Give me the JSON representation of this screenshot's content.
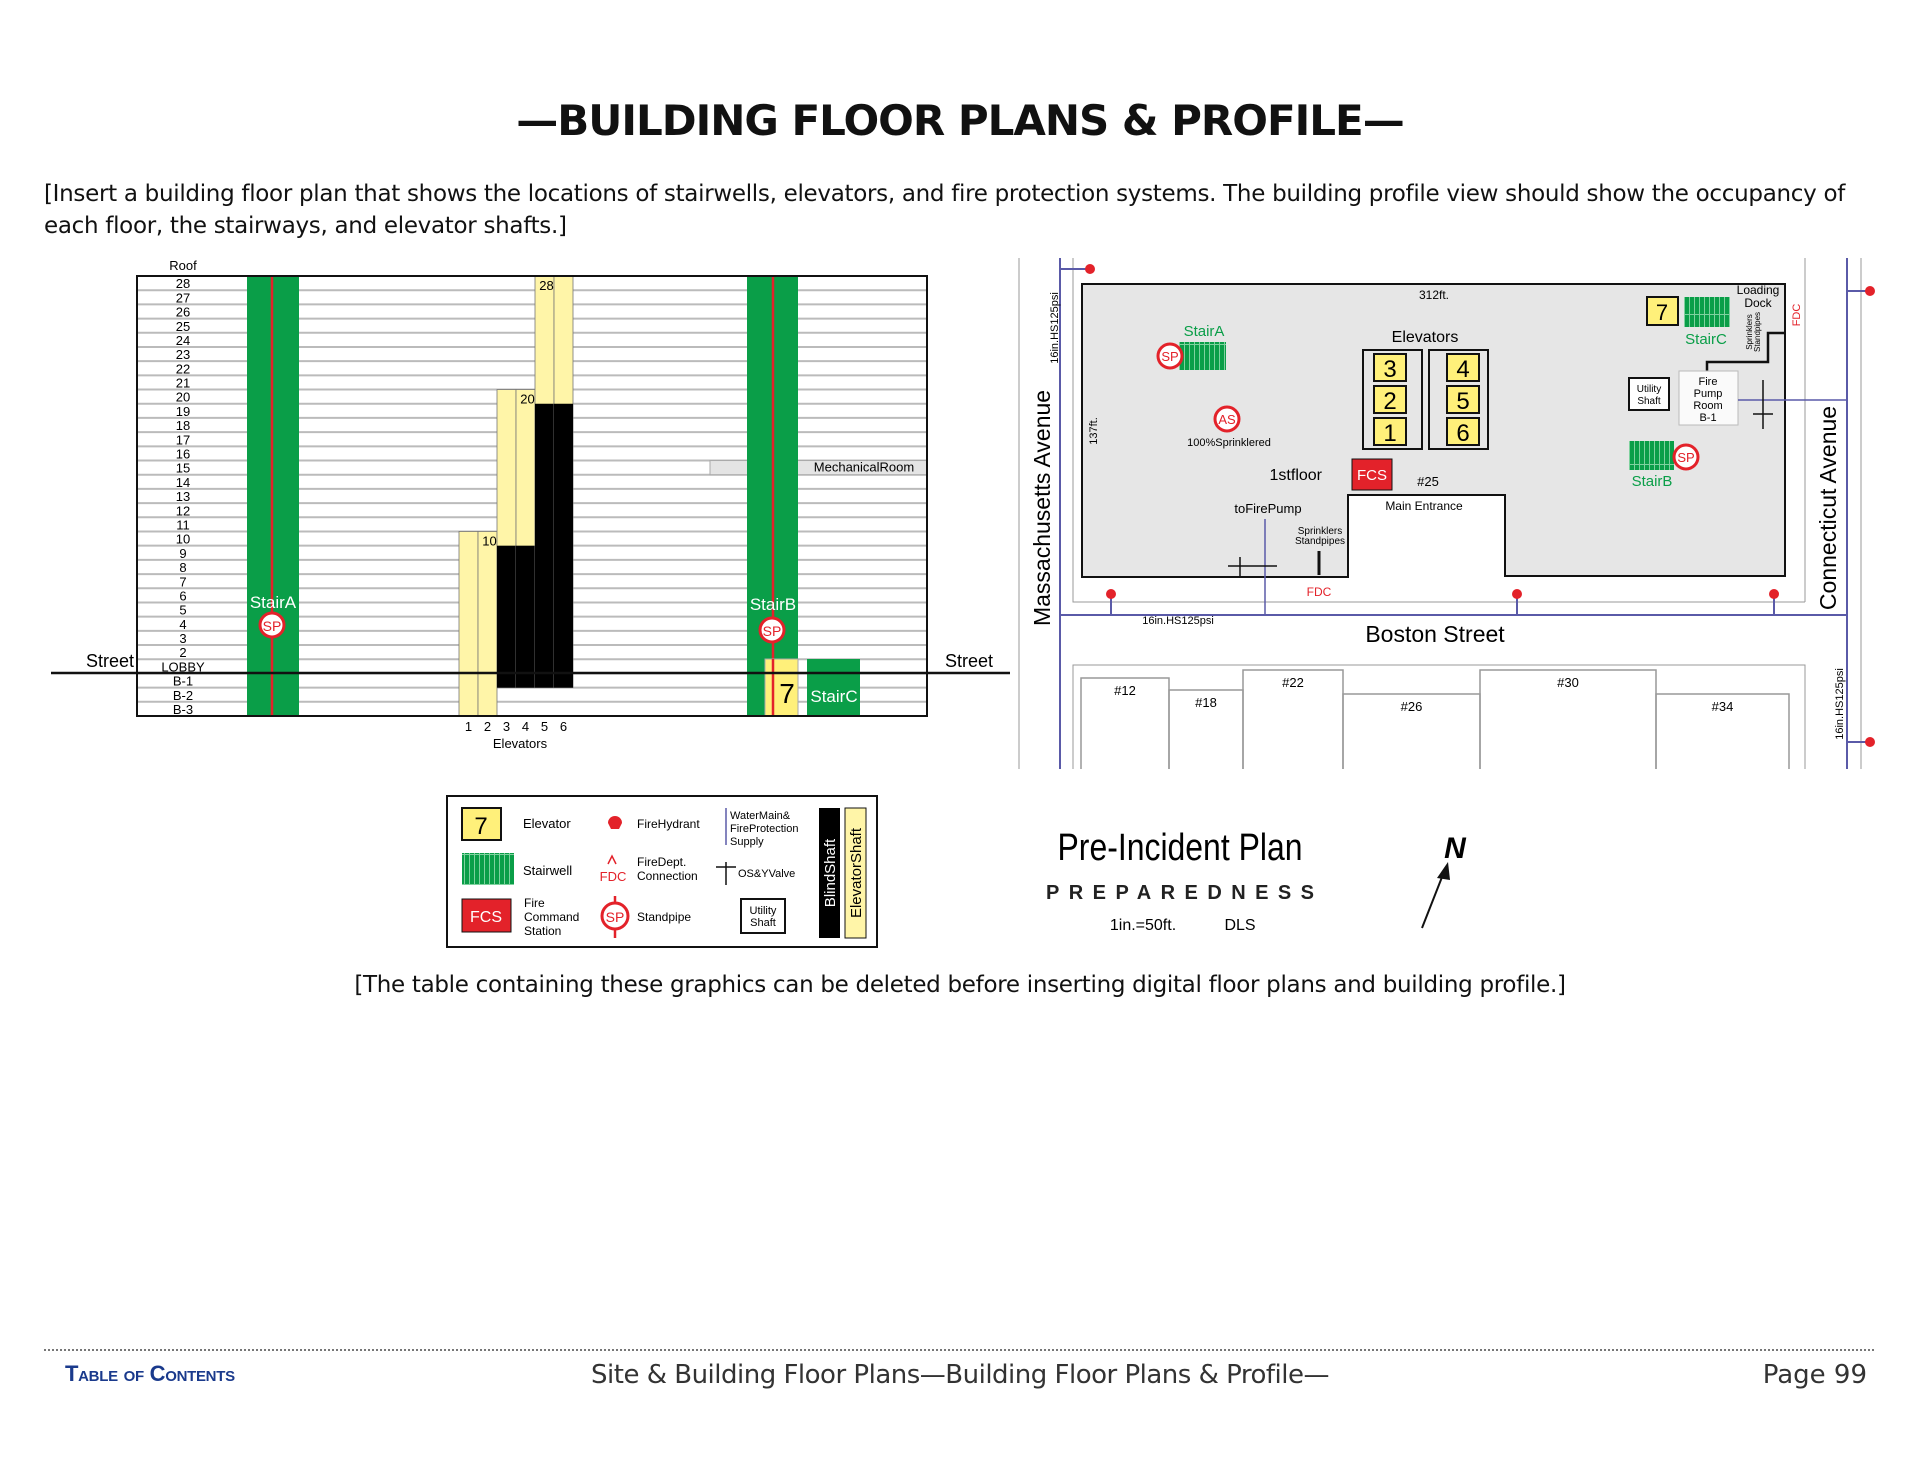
{
  "title": "—BUILDING FLOOR PLANS & PROFILE—",
  "intro": "[Insert a building floor plan that shows the locations of stairwells, elevators, and fire protection systems. The building profile view should show the occupancy of each floor, the stairways, and elevator shafts.]",
  "note": "[The table containing these graphics can be deleted before inserting digital floor plans and building profile.]",
  "profile": {
    "roof_label": "Roof",
    "floors": [
      "28",
      "27",
      "26",
      "25",
      "24",
      "23",
      "22",
      "21",
      "20",
      "19",
      "18",
      "17",
      "16",
      "15",
      "14",
      "13",
      "12",
      "11",
      "10",
      "9",
      "8",
      "7",
      "6",
      "5",
      "4",
      "3",
      "2",
      "LOBBY",
      "B-1",
      "B-2",
      "B-3"
    ],
    "street_left": "Street",
    "street_right": "Street",
    "stair_a": "StairA",
    "stair_b": "StairB",
    "stair_c": "StairC",
    "sp": "SP",
    "elevator_7": "7",
    "mechanical_room": "MechanicalRoom",
    "mechanical_floor": "15",
    "elevators_label": "Elevators",
    "elevators": [
      {
        "id": "1",
        "top": "10",
        "bottom": "B-3",
        "blind_from": null,
        "blind_to": null,
        "top_label": ""
      },
      {
        "id": "2",
        "top": "10",
        "bottom": "B-3",
        "blind_from": null,
        "blind_to": null,
        "top_label": "10"
      },
      {
        "id": "3",
        "top": "20",
        "bottom": "B-1",
        "blind_from": "9",
        "blind_to": "B-1",
        "top_label": ""
      },
      {
        "id": "4",
        "top": "20",
        "bottom": "B-1",
        "blind_from": "9",
        "blind_to": "B-1",
        "top_label": "20"
      },
      {
        "id": "5",
        "top": "28",
        "bottom": "B-1",
        "blind_from": "19",
        "blind_to": "B-1",
        "top_label": "28"
      },
      {
        "id": "6",
        "top": "28",
        "bottom": "B-1",
        "blind_from": "19",
        "blind_to": "B-1",
        "top_label": ""
      }
    ]
  },
  "map": {
    "main_left": "16in.HS125psi",
    "main_bottom": "16in.HS125psi",
    "main_right": "16in.HS125psi",
    "mass_ave": "Massachusetts Avenue",
    "conn_ave": "Connecticut Avenue",
    "boston_st": "Boston Street",
    "width_ft": "312ft.",
    "depth_ft": "137ft.",
    "stair_a": "StairA",
    "stair_b": "StairB",
    "stair_c": "StairC",
    "sp": "SP",
    "as": "AS",
    "sprinklered": "100%Sprinklered",
    "elevators_label": "Elevators",
    "elevator_cars": [
      "3",
      "2",
      "1",
      "4",
      "5",
      "6"
    ],
    "elevator_7": "7",
    "first_floor": "1stfloor",
    "fcs": "FCS",
    "address": "#25",
    "main_entrance": "Main Entrance",
    "to_fire_pump": "toFirePump",
    "sprinklers": "Sprinklers",
    "standpipes": "Standpipes",
    "fdc": "FDC",
    "loading": "Loading",
    "dock": "Dock",
    "utility": "Utility",
    "shaft": "Shaft",
    "fire_pump_room": [
      "Fire",
      "Pump",
      "Room",
      "B-1"
    ],
    "neighbors": [
      "#12",
      "#18",
      "#22",
      "#26",
      "#30",
      "#34"
    ]
  },
  "legend": {
    "elevator_num": "7",
    "elevator": "Elevator",
    "stairwell": "Stairwell",
    "fcs": "FCS",
    "fcs_label": [
      "Fire",
      "Command",
      "Station"
    ],
    "hydrant": "FireHydrant",
    "fdc": "FDC",
    "fdc_label": [
      "FireDept.",
      "Connection"
    ],
    "sp": "SP",
    "standpipe": "Standpipe",
    "water_main": [
      "WaterMain&",
      "FireProtection",
      "Supply"
    ],
    "osy": "OS&YValve",
    "utility": [
      "Utility",
      "Shaft"
    ],
    "blind_shaft": "BlindShaft",
    "elevator_shaft": "ElevatorShaft"
  },
  "brand": {
    "plan": "Pre-Incident Plan",
    "preparedness": "PREPAREDNESS",
    "scale": "1in.=50ft.",
    "author": "DLS",
    "north": "N"
  },
  "colors": {
    "stair_green": "#0a9e48",
    "elevator_yellow": "#fff5a8",
    "fcs_red": "#e3222a",
    "water_blue": "#5a5aa8",
    "building_gray": "#e6e6e6",
    "toc_blue": "#1a3a8c"
  },
  "footer": {
    "toc": "Table of Contents",
    "section": "Site & Building Floor Plans—Building Floor Plans & Profile—",
    "page": "Page 99"
  }
}
